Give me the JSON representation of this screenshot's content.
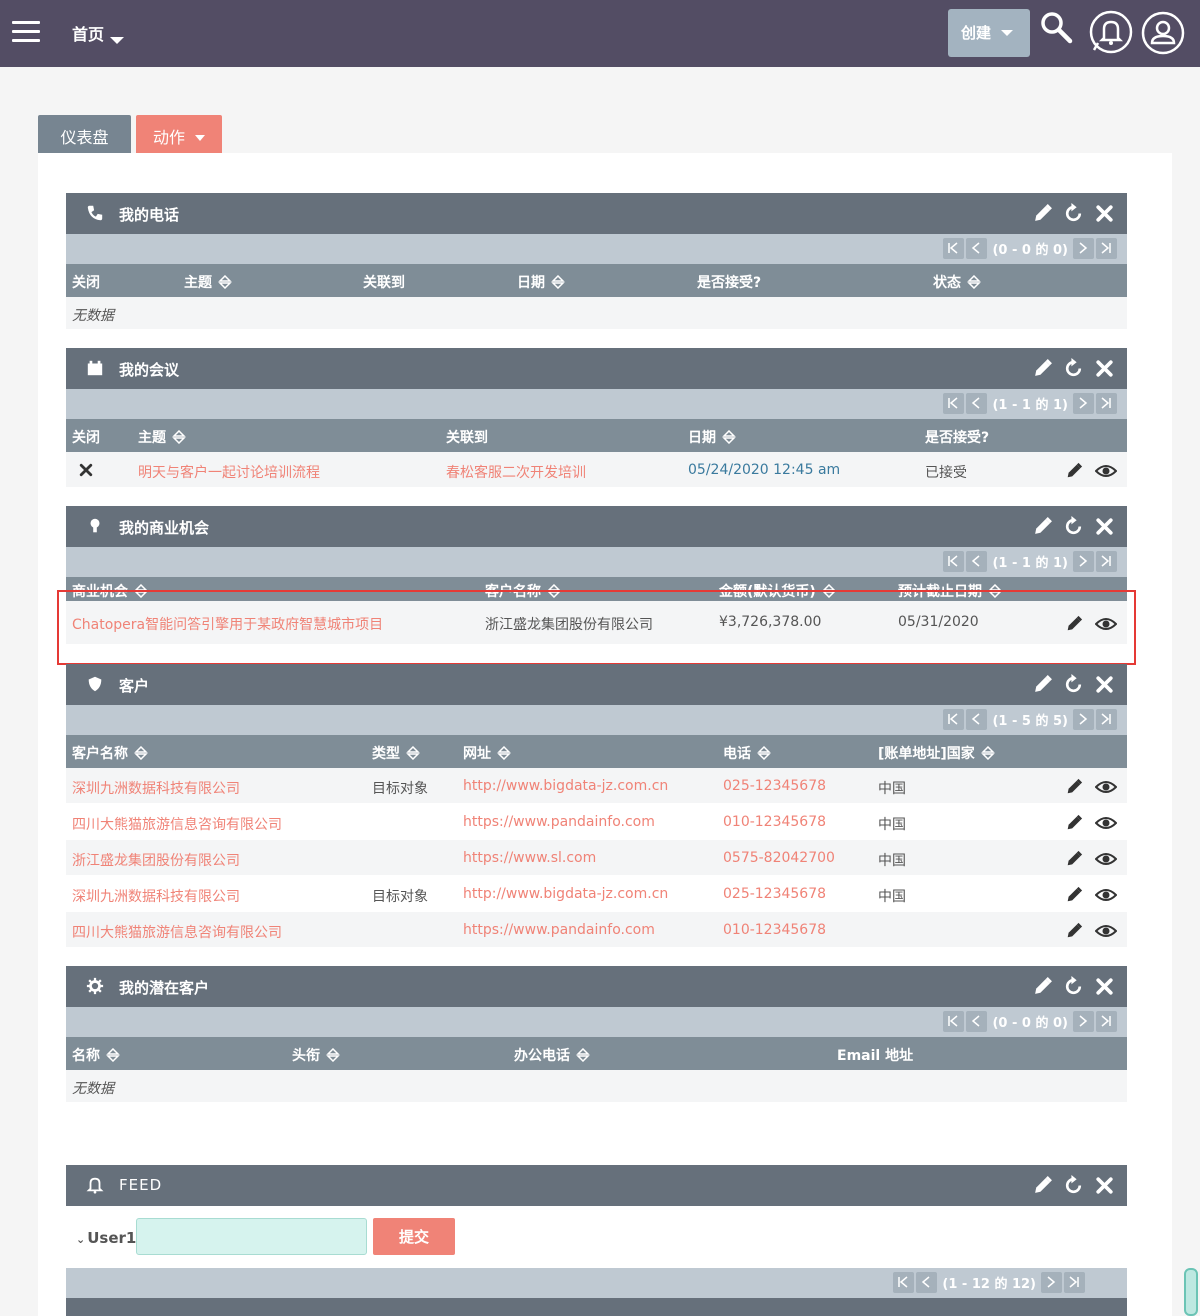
{
  "topbar": {
    "home_label": "首页",
    "create_label": "创建",
    "icons": [
      "menu-icon",
      "search-icon",
      "bell-icon",
      "user-icon"
    ]
  },
  "tabs": {
    "dashboard": "仪表盘",
    "action": "动作"
  },
  "calls": {
    "title": "我的电话",
    "pager": "(0 - 0 的 0)",
    "columns": [
      "关闭",
      "主题",
      "关联到",
      "日期",
      "是否接受?",
      "状态"
    ],
    "no_data": "无数据"
  },
  "meetings": {
    "title": "我的会议",
    "pager": "(1 - 1 的 1)",
    "columns": [
      "关闭",
      "主题",
      "关联到",
      "日期",
      "是否接受?"
    ],
    "rows": [
      {
        "subject": "明天与客户一起讨论培训流程",
        "related": "春松客服二次开发培训",
        "date": "05/24/2020 12:45 am",
        "accepted": "已接受"
      }
    ]
  },
  "opportunities": {
    "title": "我的商业机会",
    "pager": "(1 - 1 的 1)",
    "columns": [
      "商业机会",
      "客户名称",
      "金额(默认货币)",
      "预计截止日期"
    ],
    "rows": [
      {
        "name": "Chatopera智能问答引擎用于某政府智慧城市项目",
        "account": "浙江盛龙集团股份有限公司",
        "amount": "¥3,726,378.00",
        "close_date": "05/31/2020"
      }
    ]
  },
  "accounts": {
    "title": "客户",
    "pager": "(1 - 5 的 5)",
    "columns": [
      "客户名称",
      "类型",
      "网址",
      "电话",
      "[账单地址]国家"
    ],
    "rows": [
      {
        "name": "深圳九洲数据科技有限公司",
        "type": "目标对象",
        "url": "http://www.bigdata-jz.com.cn",
        "phone": "025-12345678",
        "country": "中国"
      },
      {
        "name": "四川大熊猫旅游信息咨询有限公司",
        "type": "",
        "url": "https://www.pandainfo.com",
        "phone": "010-12345678",
        "country": "中国"
      },
      {
        "name": "浙江盛龙集团股份有限公司",
        "type": "",
        "url": "https://www.sl.com",
        "phone": "0575-82042700",
        "country": "中国"
      },
      {
        "name": "深圳九洲数据科技有限公司",
        "type": "目标对象",
        "url": "http://www.bigdata-jz.com.cn",
        "phone": "025-12345678",
        "country": "中国"
      },
      {
        "name": "四川大熊猫旅游信息咨询有限公司",
        "type": "",
        "url": "https://www.pandainfo.com",
        "phone": "010-12345678",
        "country": ""
      }
    ]
  },
  "leads": {
    "title": "我的潜在客户",
    "pager": "(0 - 0 的 0)",
    "columns": [
      "名称",
      "头衔",
      "办公电话",
      "Email 地址"
    ],
    "no_data": "无数据"
  },
  "feed": {
    "title": "FEED",
    "user": "User1",
    "input_value": "",
    "submit_label": "提交",
    "pager": "(1 - 12 的 12)"
  },
  "colors": {
    "topbar": "#534d64",
    "header": "#66707b",
    "accent": "#f08377",
    "link_blue": "#3a7a9e"
  }
}
